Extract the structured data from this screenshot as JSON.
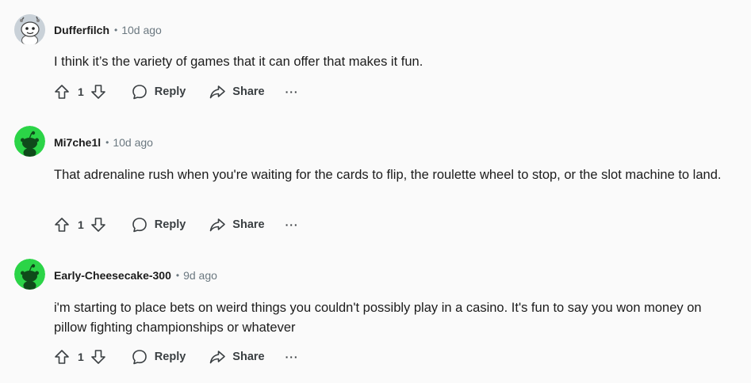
{
  "comments": [
    {
      "username": "Dufferfilch",
      "time": "10d ago",
      "text": "I think it’s the variety of games that it can offer that makes it fun.",
      "votes": "1",
      "reply_label": "Reply",
      "share_label": "Share",
      "more_label": "···",
      "avatar": "snoo-astronaut-avatar"
    },
    {
      "username": "Mi7che1l",
      "time": "10d ago",
      "text": "That adrenaline rush when you're waiting for the cards to flip, the roulette wheel to stop, or the slot machine to land.",
      "votes": "1",
      "reply_label": "Reply",
      "share_label": "Share",
      "more_label": "···",
      "avatar": "snoo-green-avatar"
    },
    {
      "username": "Early-Cheesecake-300",
      "time": "9d ago",
      "text": "i'm starting to place bets on weird things you couldn't possibly play in a casino. It's fun to say you won money on pillow fighting championships or whatever",
      "votes": "1",
      "reply_label": "Reply",
      "share_label": "Share",
      "more_label": "···",
      "avatar": "snoo-green-avatar"
    }
  ],
  "colors": {
    "background": "#fafafa",
    "text": "#1c1c1c",
    "meta": "#6b7880",
    "action": "#3a3f42",
    "avatar_green": "#2bd447"
  },
  "separator": "•"
}
